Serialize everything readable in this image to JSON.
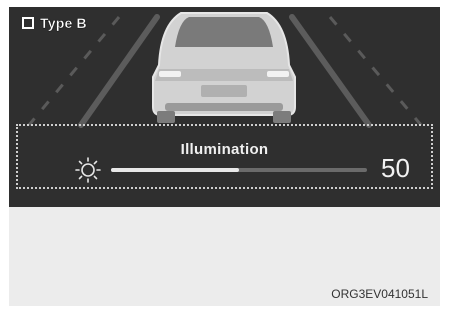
{
  "header": {
    "type_label": "Type B",
    "checkbox_checked": false
  },
  "scene": {
    "description_icon": "car-rear-view-icon"
  },
  "illumination": {
    "title": "Illumination",
    "value": "50",
    "level_fraction": 0.5,
    "icon": "sun-icon"
  },
  "footer": {
    "code": "ORG3EV041051L"
  },
  "colors": {
    "panel": "#2f2f2f",
    "text": "#f0f0f0",
    "track": "#6b6b6b",
    "fill": "#e8e8e8"
  }
}
